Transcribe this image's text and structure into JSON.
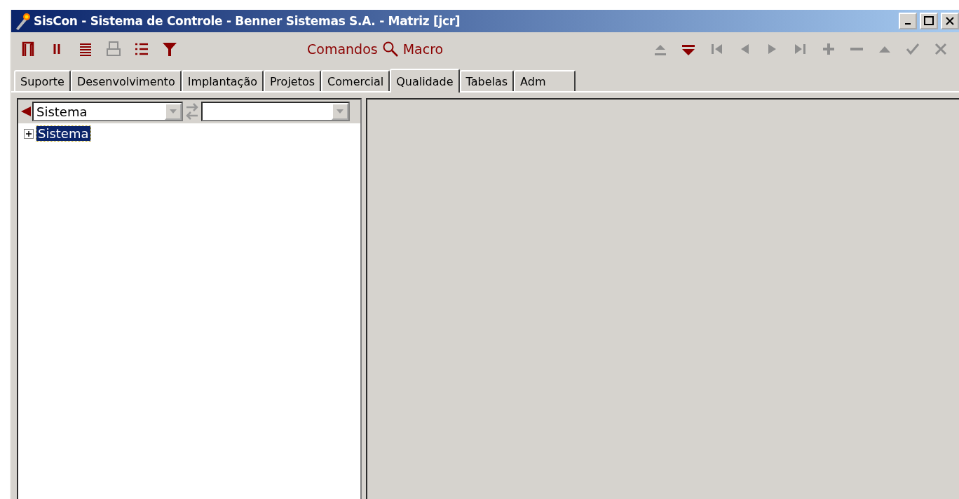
{
  "window": {
    "title": "SisCon - Sistema de Controle - Benner Sistemas S.A. - Matriz [jcr]"
  },
  "toolbar_left": [
    {
      "kind": "door",
      "disabled": false
    },
    {
      "kind": "pause",
      "disabled": false
    },
    {
      "kind": "lines",
      "disabled": false
    },
    {
      "kind": "printer",
      "disabled": true
    },
    {
      "kind": "list",
      "disabled": false
    },
    {
      "kind": "filter",
      "disabled": false
    }
  ],
  "commands": {
    "label": "Comandos",
    "macro": "Macro"
  },
  "toolbar_right": [
    {
      "kind": "eject",
      "disabled": true
    },
    {
      "kind": "drop",
      "disabled": false
    },
    {
      "kind": "first",
      "disabled": true
    },
    {
      "kind": "prev",
      "disabled": true
    },
    {
      "kind": "next",
      "disabled": true
    },
    {
      "kind": "last",
      "disabled": true
    },
    {
      "kind": "plus",
      "disabled": true
    },
    {
      "kind": "minus",
      "disabled": true
    },
    {
      "kind": "up",
      "disabled": true
    },
    {
      "kind": "check",
      "disabled": true
    },
    {
      "kind": "cancel",
      "disabled": true
    }
  ],
  "tabs": [
    {
      "label": "Suporte",
      "selected": false
    },
    {
      "label": "Desenvolvimento",
      "selected": false
    },
    {
      "label": "Implantação",
      "selected": false
    },
    {
      "label": "Projetos",
      "selected": false
    },
    {
      "label": "Comercial",
      "selected": false
    },
    {
      "label": "Qualidade",
      "selected": true
    },
    {
      "label": "Tabelas",
      "selected": false
    },
    {
      "label": "Adm",
      "selected": false
    }
  ],
  "filter": {
    "value": "Sistema"
  },
  "tree": [
    {
      "label": "Sistema",
      "selected": true,
      "expanded": false
    }
  ]
}
